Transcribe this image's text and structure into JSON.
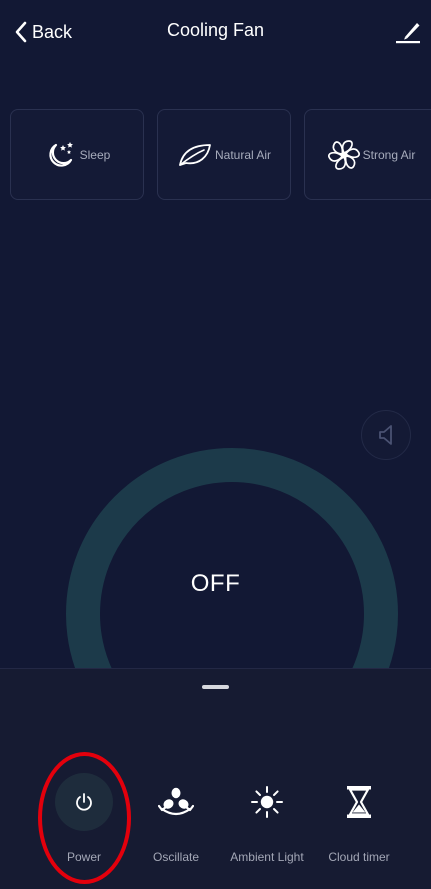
{
  "header": {
    "back_label": "Back",
    "title": "Cooling Fan"
  },
  "modes": [
    {
      "label": "Sleep",
      "icon": "sleep-moon-icon"
    },
    {
      "label": "Natural Air",
      "icon": "leaf-icon"
    },
    {
      "label": "Strong Air",
      "icon": "fan-blades-icon"
    }
  ],
  "status": {
    "text": "OFF"
  },
  "functions": [
    {
      "label": "Power",
      "icon": "power-icon"
    },
    {
      "label": "Oscillate",
      "icon": "oscillate-fan-icon"
    },
    {
      "label": "Ambient Light",
      "icon": "sun-icon"
    },
    {
      "label": "Cloud timer",
      "icon": "hourglass-icon"
    }
  ],
  "colors": {
    "background": "#121834",
    "panel": "#161b32",
    "dial_ring": "#1c3a4a",
    "power_button": "#1e2c3c",
    "annotation": "#e3000c"
  }
}
